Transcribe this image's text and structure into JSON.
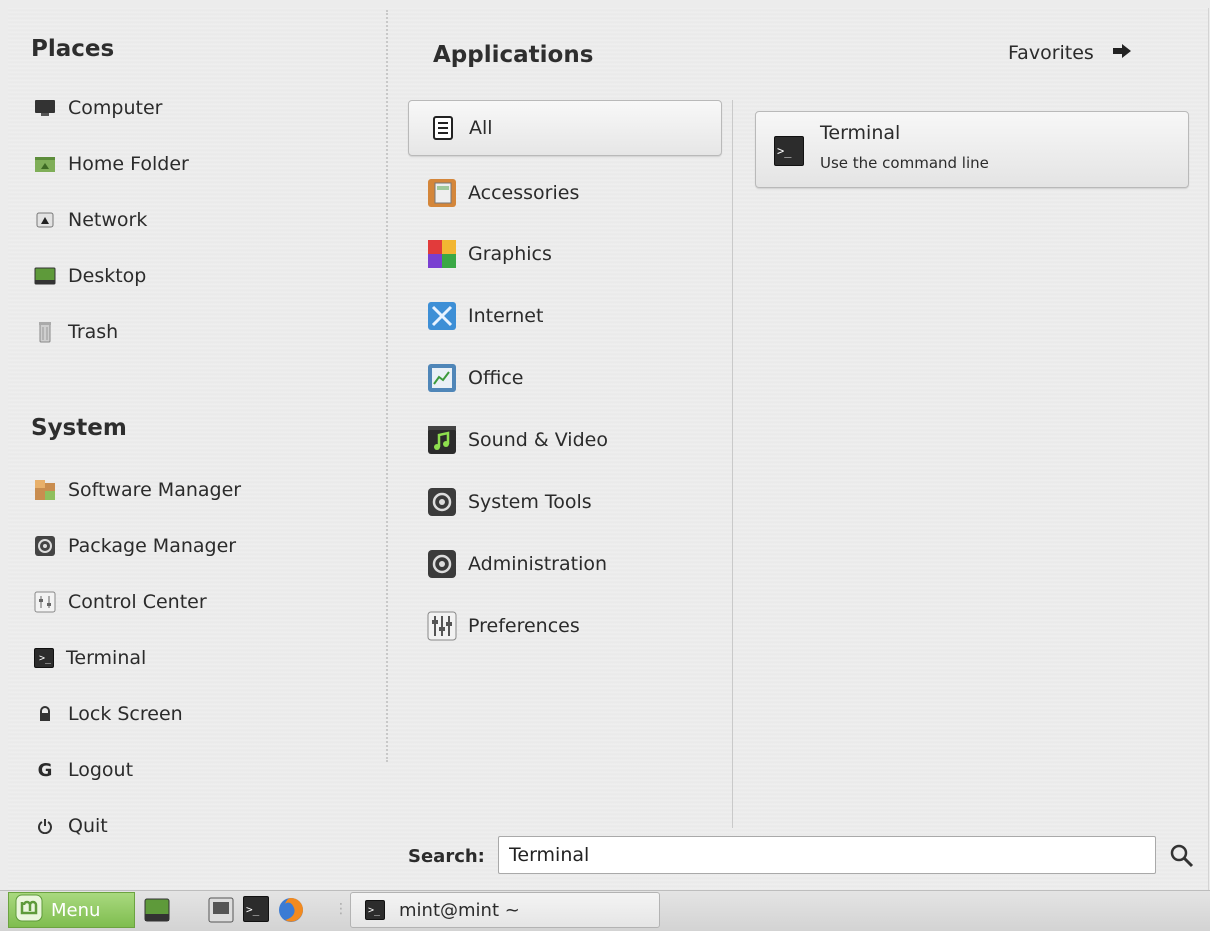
{
  "places": {
    "title": "Places",
    "items": [
      {
        "label": "Computer",
        "icon": "computer-icon"
      },
      {
        "label": "Home Folder",
        "icon": "home-folder-icon"
      },
      {
        "label": "Network",
        "icon": "network-icon"
      },
      {
        "label": "Desktop",
        "icon": "desktop-icon"
      },
      {
        "label": "Trash",
        "icon": "trash-icon"
      }
    ]
  },
  "system": {
    "title": "System",
    "items": [
      {
        "label": "Software Manager",
        "icon": "software-manager-icon"
      },
      {
        "label": "Package Manager",
        "icon": "package-manager-icon"
      },
      {
        "label": "Control Center",
        "icon": "control-center-icon"
      },
      {
        "label": "Terminal",
        "icon": "terminal-icon"
      },
      {
        "label": "Lock Screen",
        "icon": "lock-icon"
      },
      {
        "label": "Logout",
        "icon": "logout-icon"
      },
      {
        "label": "Quit",
        "icon": "power-icon"
      }
    ]
  },
  "applications": {
    "title": "Applications",
    "favorites_label": "Favorites",
    "categories": [
      {
        "label": "All",
        "icon": "all-icon",
        "selected": true
      },
      {
        "label": "Accessories",
        "icon": "accessories-icon"
      },
      {
        "label": "Graphics",
        "icon": "graphics-icon"
      },
      {
        "label": "Internet",
        "icon": "internet-icon"
      },
      {
        "label": "Office",
        "icon": "office-icon"
      },
      {
        "label": "Sound & Video",
        "icon": "sound-video-icon"
      },
      {
        "label": "System Tools",
        "icon": "system-tools-icon"
      },
      {
        "label": "Administration",
        "icon": "administration-icon"
      },
      {
        "label": "Preferences",
        "icon": "preferences-icon"
      }
    ],
    "results": [
      {
        "name": "Terminal",
        "description": "Use the command line",
        "icon": "terminal-icon"
      }
    ]
  },
  "search": {
    "label": "Search:",
    "value": "Terminal"
  },
  "taskbar": {
    "menu_label": "Menu",
    "window_label": "mint@mint ~"
  },
  "colors": {
    "menu_button": "#8cc65c",
    "accent": "#7fbd4f"
  }
}
